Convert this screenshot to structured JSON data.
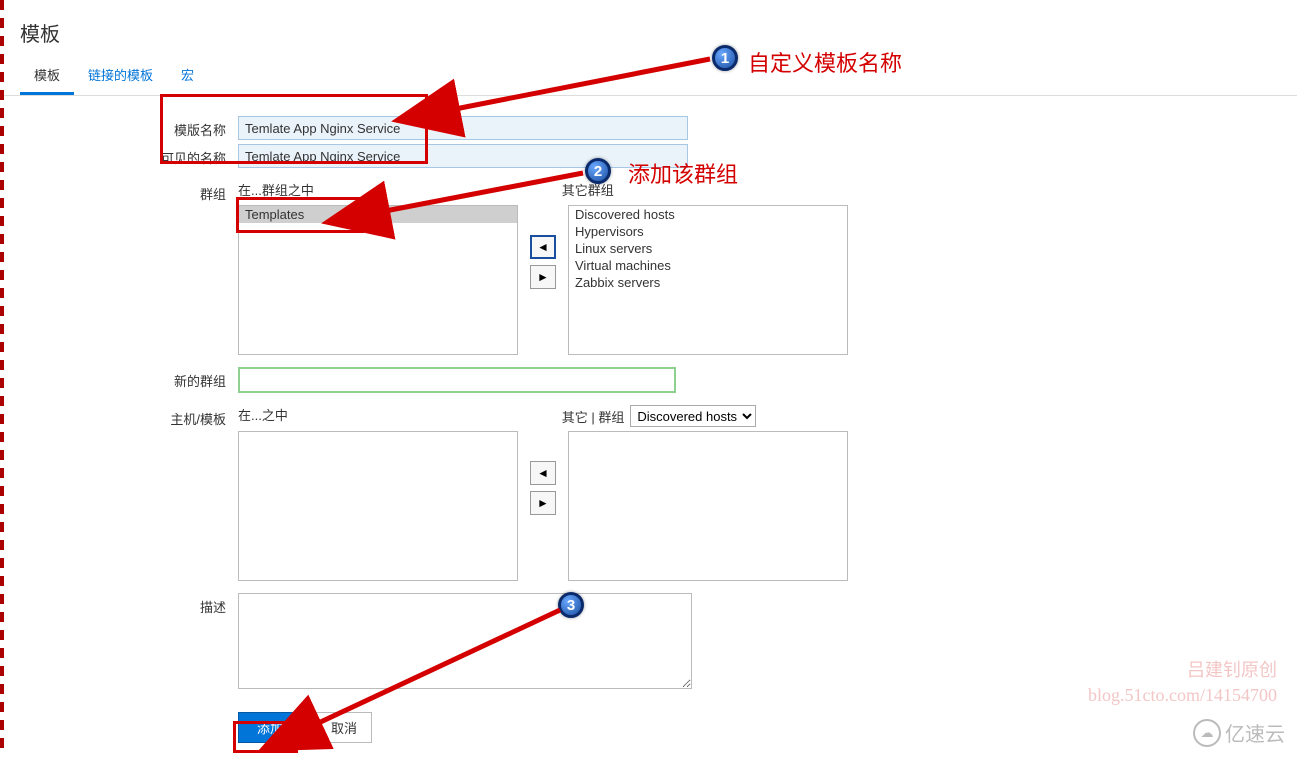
{
  "header": {
    "title": "模板"
  },
  "tabs": {
    "template": "模板",
    "linked": "链接的模板",
    "macros": "宏"
  },
  "labels": {
    "template_name": "模版名称",
    "visible_name": "可见的名称",
    "groups_label": "群组",
    "in_group": "在...群组之中",
    "other_groups": "其它群组",
    "new_group": "新的群组",
    "hosts_templates": "主机/模板",
    "in": "在...之中",
    "other_hosts_label": "其它 | 群组",
    "description": "描述"
  },
  "fields": {
    "template_name_value": "Temlate App Nginx Service",
    "visible_name_value": "Temlate App Nginx Service",
    "new_group_value": "",
    "description_value": ""
  },
  "group_left": [
    "Templates"
  ],
  "group_right": [
    "Discovered hosts",
    "Hypervisors",
    "Linux servers",
    "Virtual machines",
    "Zabbix servers"
  ],
  "hosts_combo_selected": "Discovered hosts",
  "buttons": {
    "add": "添加",
    "cancel": "取消",
    "left": "◄",
    "right": "►"
  },
  "annotations": {
    "badge1": "1",
    "text1": "自定义模板名称",
    "badge2": "2",
    "text2": "添加该群组",
    "badge3": "3"
  },
  "watermark": {
    "line1": "吕建钊原创",
    "line2": "blog.51cto.com/14154700",
    "logo_text": "亿速云"
  }
}
